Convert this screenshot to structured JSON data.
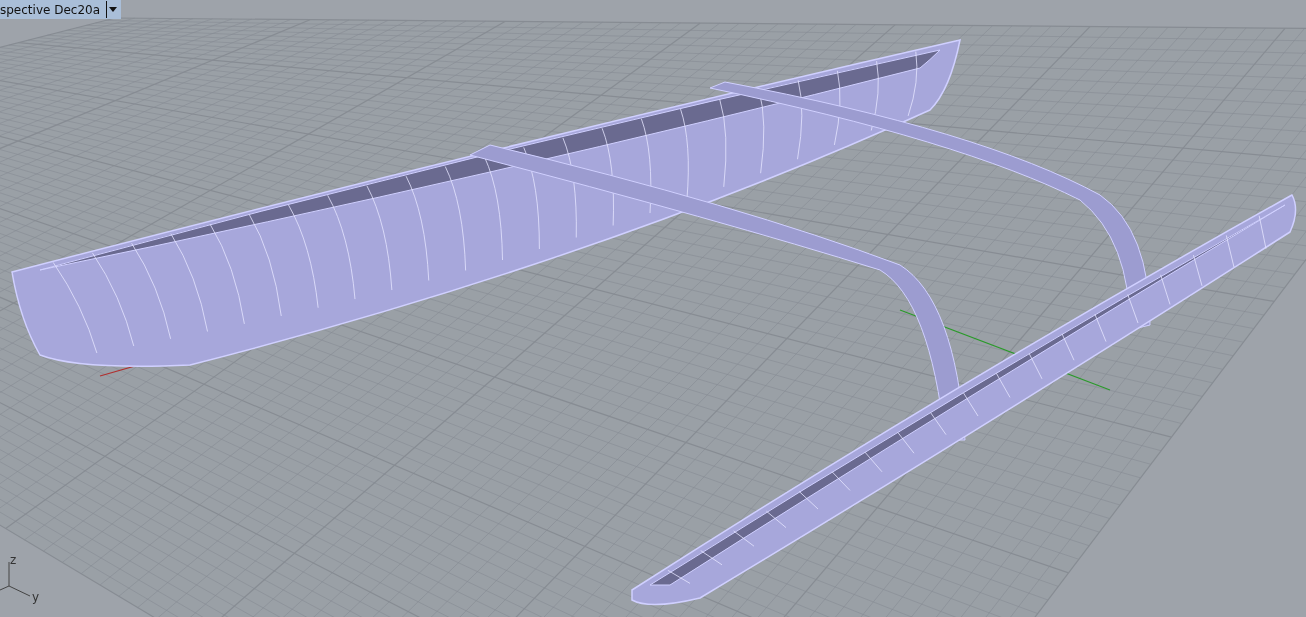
{
  "viewport": {
    "title": "spective Dec20a"
  },
  "axis_gizmo": {
    "labels": [
      {
        "kind": "z",
        "text": "z"
      },
      {
        "kind": "y",
        "text": "y"
      }
    ]
  }
}
